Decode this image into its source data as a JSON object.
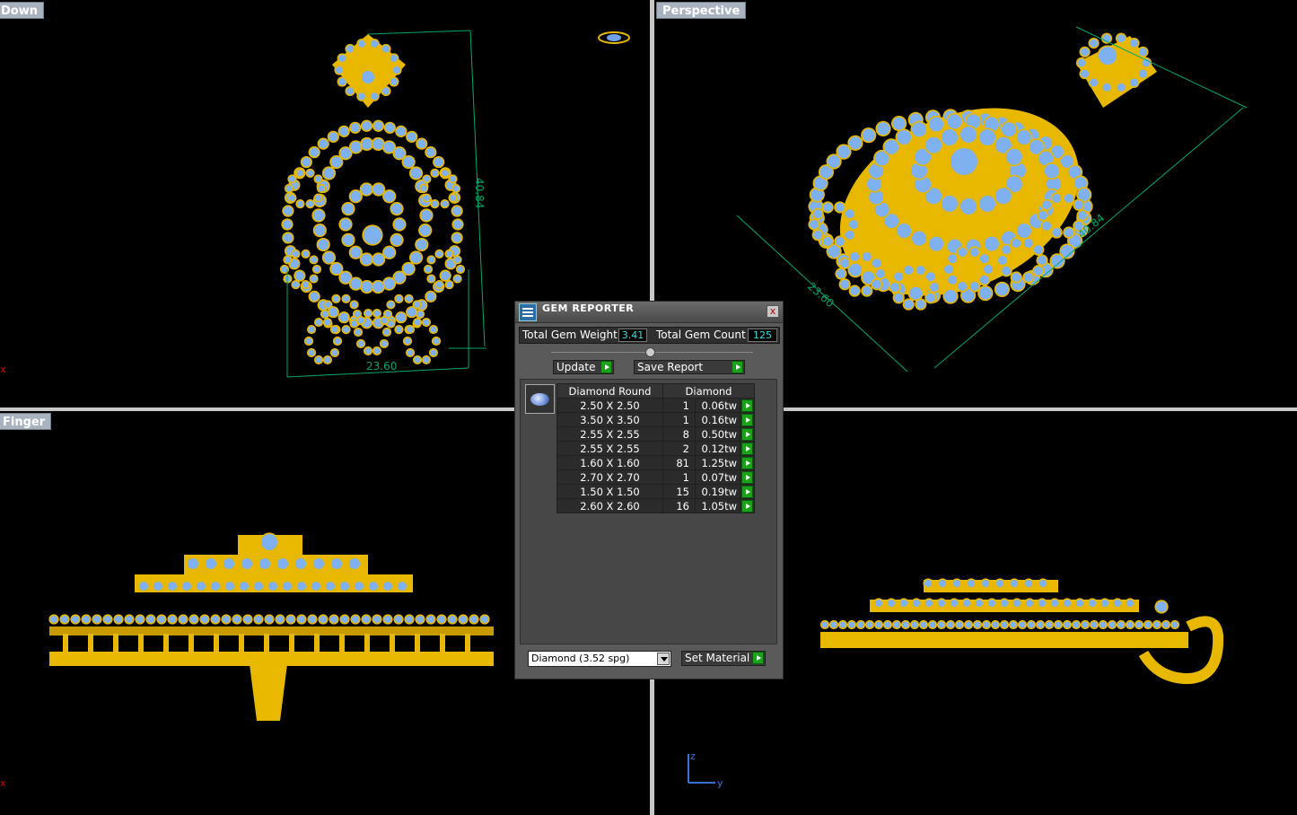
{
  "viewports": {
    "top": {
      "label": "Down"
    },
    "perspective": {
      "label": "Perspective"
    },
    "front": {
      "label": "Finger"
    },
    "right": {
      "label": ""
    }
  },
  "dimensions": {
    "top_width": "23.60",
    "top_height": "40.84",
    "persp_width": "23.60",
    "persp_height": "40.84"
  },
  "axes": {
    "x": "x",
    "z": "z",
    "y": "y"
  },
  "gem_reporter": {
    "title": "GEM REPORTER",
    "close": "x",
    "total_weight_label": "Total Gem Weight",
    "total_weight": "3.41",
    "total_count_label": "Total Gem Count",
    "total_count": "125",
    "update_label": "Update",
    "save_label": "Save Report",
    "columns": [
      "Diamond Round",
      "Diamond"
    ],
    "rows": [
      {
        "size": "2.50 X 2.50",
        "count": "1",
        "weight": "0.06tw"
      },
      {
        "size": "3.50 X 3.50",
        "count": "1",
        "weight": "0.16tw"
      },
      {
        "size": "2.55 X 2.55",
        "count": "8",
        "weight": "0.50tw"
      },
      {
        "size": "2.55 X 2.55",
        "count": "2",
        "weight": "0.12tw"
      },
      {
        "size": "1.60 X 1.60",
        "count": "81",
        "weight": "1.25tw"
      },
      {
        "size": "2.70 X 2.70",
        "count": "1",
        "weight": "0.07tw"
      },
      {
        "size": "1.50 X 1.50",
        "count": "15",
        "weight": "0.19tw"
      },
      {
        "size": "2.60 X 2.60",
        "count": "16",
        "weight": "1.05tw"
      }
    ],
    "material_select": "Diamond     (3.52 spg)",
    "set_material_label": "Set Material"
  }
}
